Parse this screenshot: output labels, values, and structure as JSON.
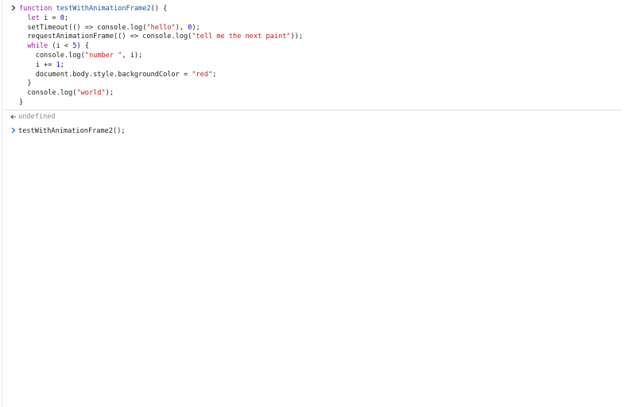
{
  "console": {
    "input_block": {
      "prompt_icon": "chevron-right-icon",
      "lines": [
        [
          {
            "t": "kw",
            "s": "function "
          },
          {
            "t": "fn",
            "s": "testWithAnimationFrame2"
          },
          {
            "t": "plain",
            "s": "() {"
          }
        ],
        [
          {
            "t": "plain",
            "s": "  "
          },
          {
            "t": "kw2",
            "s": "let"
          },
          {
            "t": "plain",
            "s": " i = "
          },
          {
            "t": "num",
            "s": "0"
          },
          {
            "t": "plain",
            "s": ";"
          }
        ],
        [
          {
            "t": "plain",
            "s": "  setTimeout(() => console.log("
          },
          {
            "t": "str",
            "s": "\"hello\""
          },
          {
            "t": "plain",
            "s": "), "
          },
          {
            "t": "num",
            "s": "0"
          },
          {
            "t": "plain",
            "s": ");"
          }
        ],
        [
          {
            "t": "plain",
            "s": "  requestAnimationFrame(() => console.log("
          },
          {
            "t": "str",
            "s": "\"tell me the next paint\""
          },
          {
            "t": "plain",
            "s": "));"
          }
        ],
        [
          {
            "t": "plain",
            "s": "  "
          },
          {
            "t": "kw2",
            "s": "while"
          },
          {
            "t": "plain",
            "s": " (i < "
          },
          {
            "t": "num",
            "s": "5"
          },
          {
            "t": "plain",
            "s": ") {"
          }
        ],
        [
          {
            "t": "plain",
            "s": "    console.log("
          },
          {
            "t": "str",
            "s": "\"number \""
          },
          {
            "t": "plain",
            "s": ", i);"
          }
        ],
        [
          {
            "t": "plain",
            "s": "    i += "
          },
          {
            "t": "num",
            "s": "1"
          },
          {
            "t": "plain",
            "s": ";"
          }
        ],
        [
          {
            "t": "plain",
            "s": "    document.body.style.backgroundColor = "
          },
          {
            "t": "str",
            "s": "\"red\""
          },
          {
            "t": "plain",
            "s": ";"
          }
        ],
        [
          {
            "t": "plain",
            "s": "  }"
          }
        ],
        [
          {
            "t": "plain",
            "s": "  console.log("
          },
          {
            "t": "str",
            "s": "\"world\""
          },
          {
            "t": "plain",
            "s": ");"
          }
        ],
        [
          {
            "t": "plain",
            "s": "}"
          }
        ]
      ]
    },
    "result": {
      "icon": "return-arrow-icon",
      "text": "undefined"
    },
    "prompt": {
      "icon": "chevron-right-icon",
      "text": "testWithAnimationFrame2();"
    }
  },
  "colors": {
    "keyword": "#9c1ea8",
    "function_name": "#1c4fa3",
    "string": "#c41a16",
    "number": "#1c00cf",
    "muted": "#8a8a8a"
  }
}
